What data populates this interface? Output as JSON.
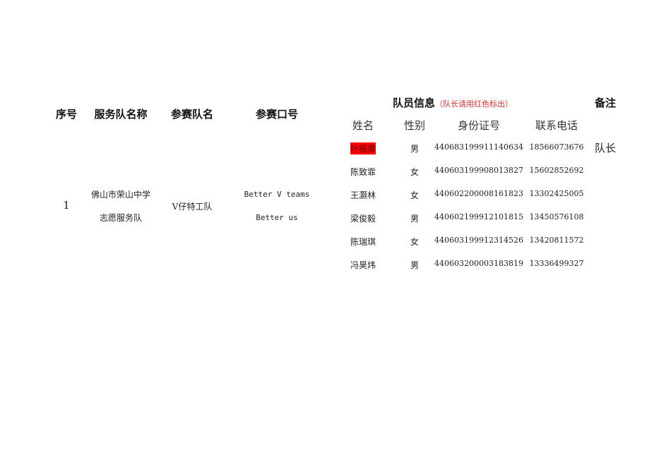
{
  "headers": {
    "seq": "序号",
    "service_team": "服务队名称",
    "team_name": "参赛队名",
    "slogan": "参赛口号",
    "members_info": "队员信息",
    "members_note": "（队长请用红色标出）",
    "remark": "备注"
  },
  "subheaders": {
    "name": "姓名",
    "gender": "性别",
    "id": "身份证号",
    "phone": "联系电话"
  },
  "entry": {
    "seq": "1",
    "service_team_line1": "佛山市荣山中学",
    "service_team_line2": "志愿服务队",
    "team_name": "V仔特工队",
    "slogan_line1": "Better V teams",
    "slogan_line2": "Better us",
    "members": [
      {
        "name": "叶振豪",
        "gender": "男",
        "id": "440683199911140634",
        "phone": "18566073676",
        "remark": "队长",
        "captain": true
      },
      {
        "name": "陈致霏",
        "gender": "女",
        "id": "440603199908013827",
        "phone": "15602852692"
      },
      {
        "name": "王灏林",
        "gender": "女",
        "id": "440602200008161823",
        "phone": "13302425005"
      },
      {
        "name": "梁俊毅",
        "gender": "男",
        "id": "440602199912101815",
        "phone": "13450576108"
      },
      {
        "name": "陈瑞琪",
        "gender": "女",
        "id": "440603199912314526",
        "phone": "13420811572"
      },
      {
        "name": "冯昊炜",
        "gender": "男",
        "id": "440603200003183819",
        "phone": "13336499327"
      }
    ]
  },
  "colors": {
    "captain_highlight": "#ff0000",
    "note": "#e03030"
  }
}
